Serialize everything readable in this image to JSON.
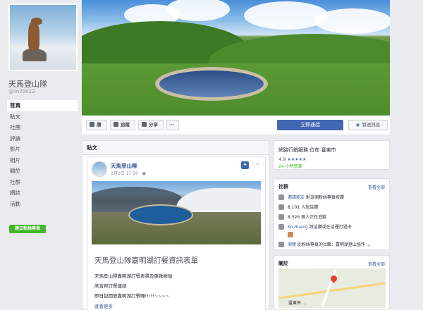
{
  "page": {
    "name": "天馬登山隊",
    "handle": "@lin78022"
  },
  "nav": [
    "首頁",
    "貼文",
    "社團",
    "評論",
    "影片",
    "相片",
    "關於",
    "社群",
    "網誌",
    "活動"
  ],
  "create_page_label": "建立粉絲專頁",
  "actions": {
    "like": "讚",
    "follow": "追蹤",
    "share": "分享",
    "more": "···",
    "primary": "立即通話",
    "message": "發送訊息"
  },
  "posts": {
    "header": "貼文",
    "author": "天馬登山隊",
    "date": "2月2日 17:56 · ",
    "title": "天馬登山隊嘉明湖訂餐資訊表單",
    "lines": [
      "天馬登山隊嘉明湖訂餐表單及匯款帳號",
      "席吉邦訂餐連結",
      "即日起開放嘉明湖訂餐囉!!!!!~~~~"
    ],
    "see_more": "查看更多"
  },
  "info": {
    "category": "網路行銷服務 位在 臺東市",
    "rating": "4.9",
    "stars": "★★★★★",
    "hours": "24 小時營業"
  },
  "community": {
    "title": "社群",
    "see_all": "查看全部",
    "rows": [
      {
        "icon": "invite-icon",
        "link": "邀請朋友",
        "text": " 對這個粉絲專頁按讚"
      },
      {
        "icon": "like-icon",
        "link": "",
        "text": "8,101 人說這讚"
      },
      {
        "icon": "follow-icon",
        "link": "",
        "text": "8,526 個人正在追蹤"
      },
      {
        "icon": "user-icon",
        "link": "Ko Huang",
        "text": " 說這讚或在這裡打過卡"
      },
      {
        "icon": "friends-icon",
        "link": "",
        "text": ""
      },
      {
        "icon": "info-icon",
        "link": "瀏覽",
        "text": " 此粉絲專頁的社團：嘉明湖登山協作 ..."
      }
    ]
  },
  "about": {
    "title": "關於",
    "see_all": "查看全部",
    "map_address": "臺東市 ..."
  }
}
